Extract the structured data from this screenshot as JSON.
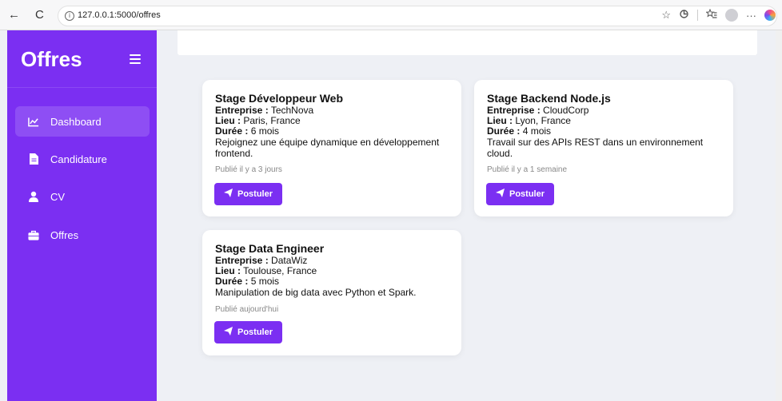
{
  "browser": {
    "url": "127.0.0.1:5000/offres",
    "back": "←",
    "refresh": "C",
    "star": "☆",
    "more": "···"
  },
  "sidebar": {
    "title": "Offres",
    "items": [
      {
        "label": "Dashboard",
        "icon": "chart-line-icon",
        "active": true
      },
      {
        "label": "Candidature",
        "icon": "file-icon",
        "active": false
      },
      {
        "label": "CV",
        "icon": "user-icon",
        "active": false
      },
      {
        "label": "Offres",
        "icon": "briefcase-icon",
        "active": false
      }
    ]
  },
  "offers": [
    {
      "title": "Stage Développeur Web",
      "company_label": "Entreprise :",
      "company": "TechNova",
      "location_label": "Lieu :",
      "location": "Paris, France",
      "duration_label": "Durée :",
      "duration": "6 mois",
      "description": "Rejoignez une équipe dynamique en développement frontend.",
      "published": "Publié il y a 3 jours",
      "button": "Postuler"
    },
    {
      "title": "Stage Backend Node.js",
      "company_label": "Entreprise :",
      "company": "CloudCorp",
      "location_label": "Lieu :",
      "location": "Lyon, France",
      "duration_label": "Durée :",
      "duration": "4 mois",
      "description": "Travail sur des APIs REST dans un environnement cloud.",
      "published": "Publié il y a 1 semaine",
      "button": "Postuler"
    },
    {
      "title": "Stage Data Engineer",
      "company_label": "Entreprise :",
      "company": "DataWiz",
      "location_label": "Lieu :",
      "location": "Toulouse, France",
      "duration_label": "Durée :",
      "duration": "5 mois",
      "description": "Manipulation de big data avec Python et Spark.",
      "published": "Publié aujourd'hui",
      "button": "Postuler"
    }
  ],
  "colors": {
    "accent": "#7b2ff2",
    "background": "#eef0f5"
  }
}
